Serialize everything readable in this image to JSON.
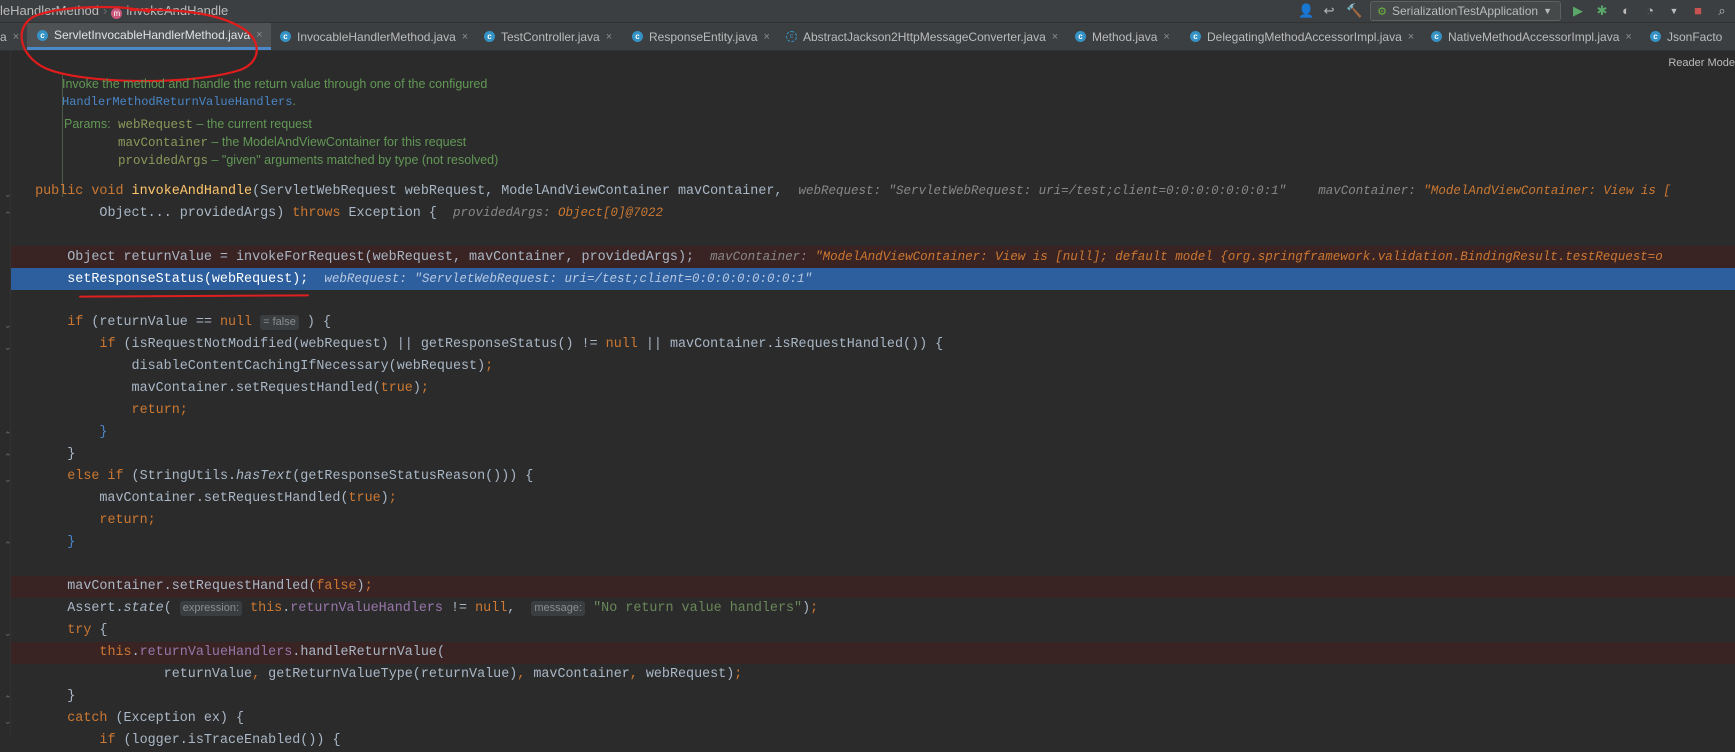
{
  "breadcrumb": {
    "class_name": "leHandlerMethod",
    "method_name": "invokeAndHandle"
  },
  "run_config": {
    "label": "SerializationTestApplication"
  },
  "tabs": [
    {
      "label": "a"
    },
    {
      "label": "ServletInvocableHandlerMethod.java"
    },
    {
      "label": "InvocableHandlerMethod.java"
    },
    {
      "label": "TestController.java"
    },
    {
      "label": "ResponseEntity.java"
    },
    {
      "label": "AbstractJackson2HttpMessageConverter.java"
    },
    {
      "label": "Method.java"
    },
    {
      "label": "DelegatingMethodAccessorImpl.java"
    },
    {
      "label": "NativeMethodAccessorImpl.java"
    },
    {
      "label": "JsonFacto"
    }
  ],
  "reader_mode": "Reader Mode",
  "javadoc": {
    "line1": "Invoke the method and handle the return value through one of the configured",
    "link": "HandlerMethodReturnValueHandlers",
    "link_suffix": ".",
    "params_label": "Params:",
    "params": [
      {
        "name": "webRequest",
        "desc": " – the current request"
      },
      {
        "name": "mavContainer",
        "desc": " – the ModelAndViewContainer for this request"
      },
      {
        "name": "providedArgs",
        "desc": " – \"given\" arguments matched by type (not resolved)"
      }
    ]
  },
  "code": {
    "l1_sig": "invokeAndHandle",
    "l1_params": "(ServletWebRequest webRequest, ModelAndViewContainer mavContainer,",
    "l1_dbg1": "webRequest: \"ServletWebRequest: uri=/test;client=0:0:0:0:0:0:0:1\"",
    "l1_dbg2_label": "mavContainer: ",
    "l1_dbg2_val": "\"ModelAndViewContainer: View is [",
    "l2_text": "Object... providedArgs) ",
    "l2_dbg_label": "providedArgs: ",
    "l2_dbg_val": "Object[0]@7022",
    "l3_text": "Object returnValue = invokeForRequest(webRequest, mavContainer, providedArgs);",
    "l3_dbg_label": "mavContainer: ",
    "l3_dbg_val": "\"ModelAndViewContainer: View is [null]; default model {org.springframework.validation.BindingResult.testRequest=o",
    "l4_text": "setResponseStatus(webRequest);",
    "l4_dbg": "webRequest: \"ServletWebRequest: uri=/test;client=0:0:0:0:0:0:0:1\"",
    "hint_false": "= false",
    "hint_expression": "expression:",
    "hint_message": "message:",
    "msg_string": "\"No return value handlers\""
  }
}
